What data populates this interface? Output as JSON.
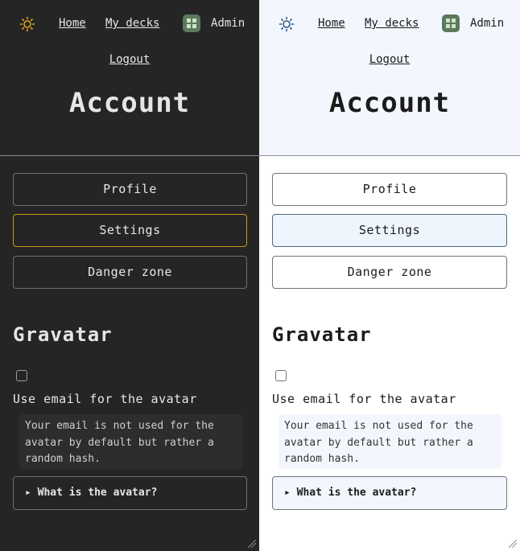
{
  "nav": {
    "home": "Home",
    "my_decks": "My decks",
    "user": "Admin",
    "logout": "Logout"
  },
  "page": {
    "title": "Account"
  },
  "tabs": [
    {
      "label": "Profile",
      "active": false
    },
    {
      "label": "Settings",
      "active": true
    },
    {
      "label": "Danger zone",
      "active": false
    }
  ],
  "gravatar": {
    "heading": "Gravatar",
    "checkbox_label": "Use email for the avatar",
    "checked": false,
    "note": "Your email is not used for the avatar by default but rather a random hash.",
    "details_summary": "▸ What is the avatar?"
  },
  "themes": {
    "dark": {
      "background": "#252525",
      "accent": "#c89b1a",
      "icon": "sun-icon"
    },
    "light": {
      "background": "#ffffff",
      "accent": "#4a6a8a",
      "icon": "sun-icon"
    }
  }
}
